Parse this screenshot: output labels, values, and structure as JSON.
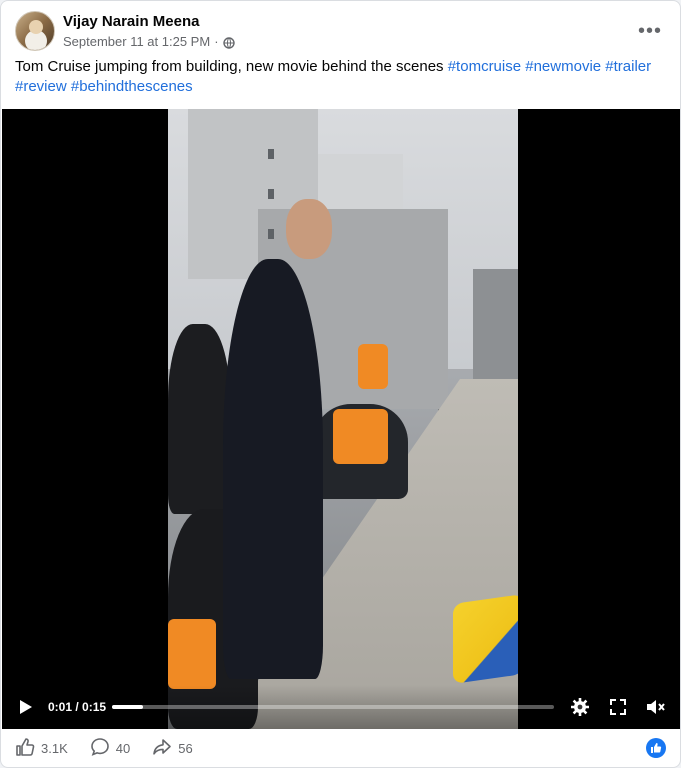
{
  "post": {
    "author": "Vijay Narain Meena",
    "timestamp": "September 11 at 1:25 PM",
    "separator": "·",
    "privacy_icon": "globe-icon",
    "more_icon": "more-options-icon",
    "more_label": "•••",
    "caption_text": "Tom Cruise jumping from building, new movie behind the scenes ",
    "hashtags": [
      "#tomcruise",
      "#newmovie",
      "#trailer",
      "#review",
      "#behindthescenes"
    ]
  },
  "video": {
    "current_time": "0:01",
    "duration": "0:15",
    "time_display": "0:01 / 0:15",
    "progress_fraction": 0.07,
    "icons": [
      "play-icon",
      "settings-icon",
      "fullscreen-icon",
      "mute-icon"
    ]
  },
  "engagement": {
    "likes": "3.1K",
    "comments": "40",
    "shares": "56",
    "icons": [
      "like-icon",
      "comment-icon",
      "share-icon",
      "like-reaction-icon"
    ]
  },
  "colors": {
    "hashtag": "#216fdb",
    "meta_text": "#65676b",
    "like_badge": "#1877f2",
    "video_bg": "#000000"
  }
}
